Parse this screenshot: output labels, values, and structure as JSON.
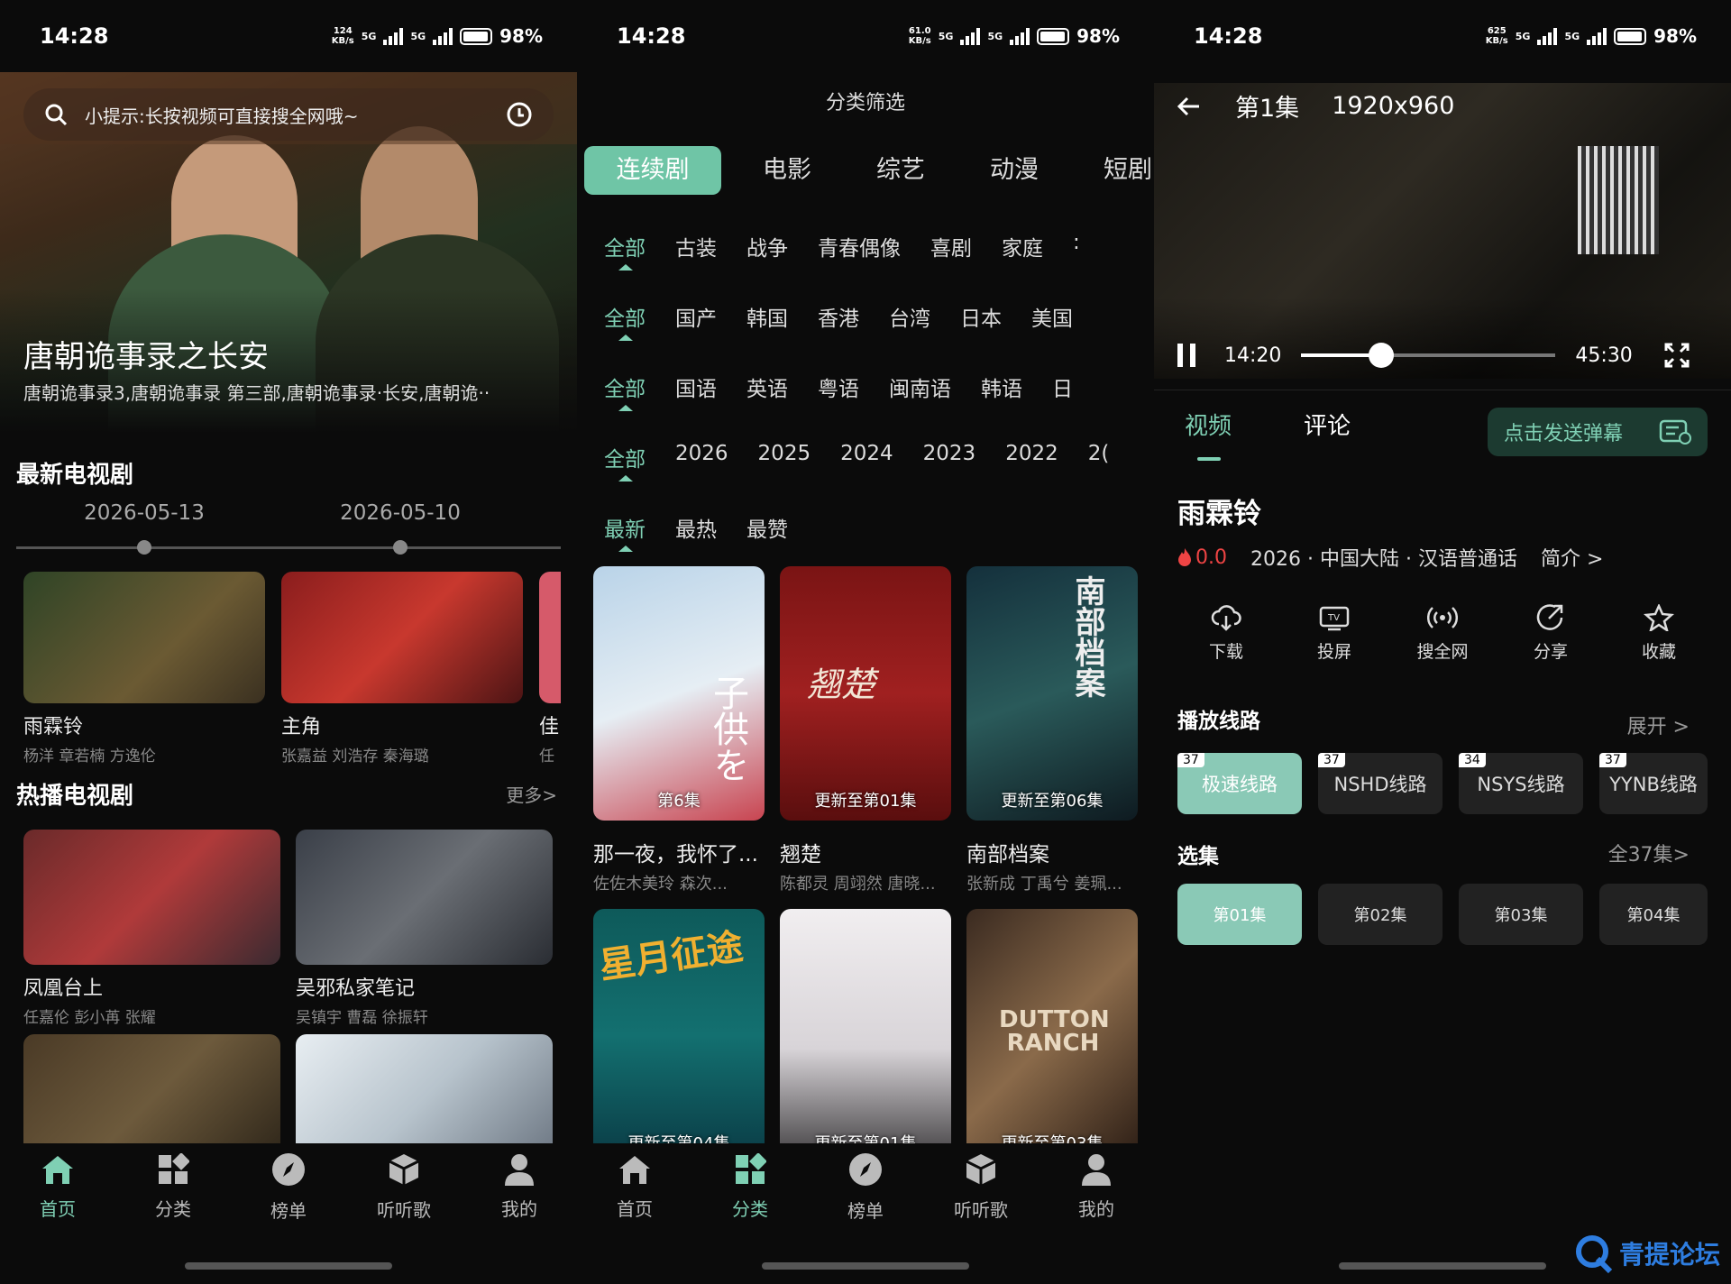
{
  "screen1": {
    "status": {
      "time": "14:28",
      "speed": "124",
      "unit": "KB/s",
      "net1": "5G",
      "net2": "5G",
      "battery": "98%"
    },
    "search_hint": "小提示:长按视频可直接搜全网哦~",
    "hero": {
      "title": "唐朝诡事录之长安",
      "subtitle": "唐朝诡事录3,唐朝诡事录 第三部,唐朝诡事录·长安,唐朝诡··"
    },
    "latest": {
      "heading": "最新电视剧",
      "dates": [
        "2026-05-13",
        "2026-05-10"
      ],
      "items": [
        {
          "title": "雨霖铃",
          "cast": "杨洋 章若楠 方逸伦"
        },
        {
          "title": "主角",
          "cast": "张嘉益 刘浩存 秦海璐"
        },
        {
          "title": "佳",
          "cast": "任"
        }
      ]
    },
    "hot": {
      "heading": "热播电视剧",
      "more": "更多>",
      "items": [
        {
          "title": "凤凰台上",
          "cast": "任嘉伦 彭小苒 张耀"
        },
        {
          "title": "吴邪私家笔记",
          "cast": "吴镇宇 曹磊 徐振轩"
        }
      ]
    }
  },
  "screen2": {
    "status": {
      "time": "14:28",
      "speed": "61.0",
      "unit": "KB/s",
      "net1": "5G",
      "net2": "5G",
      "battery": "98%"
    },
    "title": "分类筛选",
    "tabs": [
      "连续剧",
      "电影",
      "综艺",
      "动漫",
      "短剧"
    ],
    "rows": [
      [
        "全部",
        "古装",
        "战争",
        "青春偶像",
        "喜剧",
        "家庭",
        ":"
      ],
      [
        "全部",
        "国产",
        "韩国",
        "香港",
        "台湾",
        "日本",
        "美国"
      ],
      [
        "全部",
        "国语",
        "英语",
        "粤语",
        "闽南语",
        "韩语",
        "日"
      ],
      [
        "全部",
        "2026",
        "2025",
        "2024",
        "2023",
        "2022",
        "2("
      ],
      [
        "最新",
        "最热",
        "最赞"
      ]
    ],
    "posters": [
      {
        "title": "那一夜，我怀了...",
        "cast": "佐佐木美玲   森次...",
        "tag": "第6集"
      },
      {
        "title": "翘楚",
        "cast": "陈都灵 周翊然 唐晓...",
        "tag": "更新至第01集"
      },
      {
        "title": "南部档案",
        "cast": "张新成 丁禹兮 姜珮...",
        "tag": "更新至第06集"
      },
      {
        "title": "",
        "cast": "",
        "tag": "更新至第04集"
      },
      {
        "title": "",
        "cast": "",
        "tag": "更新至第01集"
      },
      {
        "title": "",
        "cast": "",
        "tag": "更新至第03集"
      }
    ],
    "poster_art": [
      "子供を",
      "翘楚",
      "南部档案",
      "星月征途",
      "",
      "DUTTON RANCH"
    ]
  },
  "screen3": {
    "status": {
      "time": "14:28",
      "speed": "625",
      "unit": "KB/s",
      "net1": "5G",
      "net2": "5G",
      "battery": "98%"
    },
    "episode": "第1集",
    "resolution": "1920x960",
    "current": "14:20",
    "duration": "45:30",
    "progress": 0.315,
    "tabs": [
      "视频",
      "评论"
    ],
    "danmu": "点击发送弹幕",
    "name": "雨霖铃",
    "score": "0.0",
    "meta": "2026 · 中国大陆 · 汉语普通话",
    "intro": "简介 >",
    "actions": [
      "下载",
      "投屏",
      "搜全网",
      "分享",
      "收藏"
    ],
    "lines_heading": "播放线路",
    "lines_more": "展开 >",
    "lines": [
      {
        "count": "37",
        "name": "极速线路"
      },
      {
        "count": "37",
        "name": "NSHD线路"
      },
      {
        "count": "34",
        "name": "NSYS线路"
      },
      {
        "count": "37",
        "name": "YYNB线路"
      }
    ],
    "eps_heading": "选集",
    "eps_more": "全37集>",
    "eps": [
      "第01集",
      "第02集",
      "第03集",
      "第04集"
    ]
  },
  "nav": [
    "首页",
    "分类",
    "榜单",
    "听听歌",
    "我的"
  ],
  "watermark": "青提论坛",
  "colors": {
    "accent": "#7fd0b4",
    "hot": "#e44444"
  }
}
